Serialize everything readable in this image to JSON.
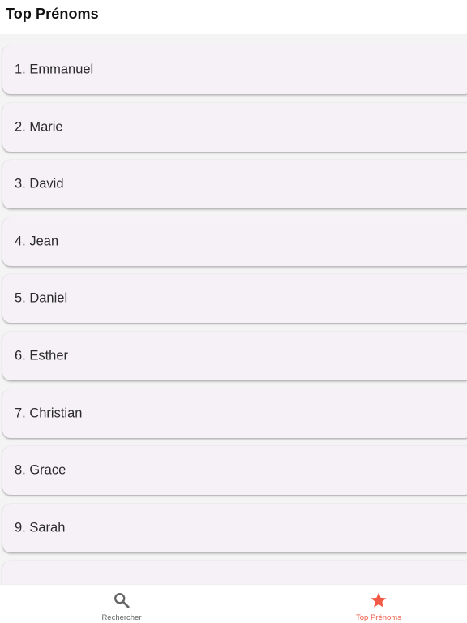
{
  "header": {
    "title": "Top Prénoms"
  },
  "list": {
    "items": [
      {
        "label": "1. Emmanuel"
      },
      {
        "label": "2. Marie"
      },
      {
        "label": "3. David"
      },
      {
        "label": "4. Jean"
      },
      {
        "label": "5. Daniel"
      },
      {
        "label": "6. Esther"
      },
      {
        "label": "7. Christian"
      },
      {
        "label": "8. Grace"
      },
      {
        "label": "9. Sarah"
      }
    ]
  },
  "bottom_nav": {
    "items": [
      {
        "label": "Rechercher",
        "icon": "search-icon",
        "active": false
      },
      {
        "label": "Top Prénoms",
        "icon": "star-icon",
        "active": true
      }
    ]
  },
  "colors": {
    "accent": "#f25a45",
    "inactive": "#666666",
    "card_background": "#f5f1f7",
    "page_background": "#f4f4f4"
  }
}
